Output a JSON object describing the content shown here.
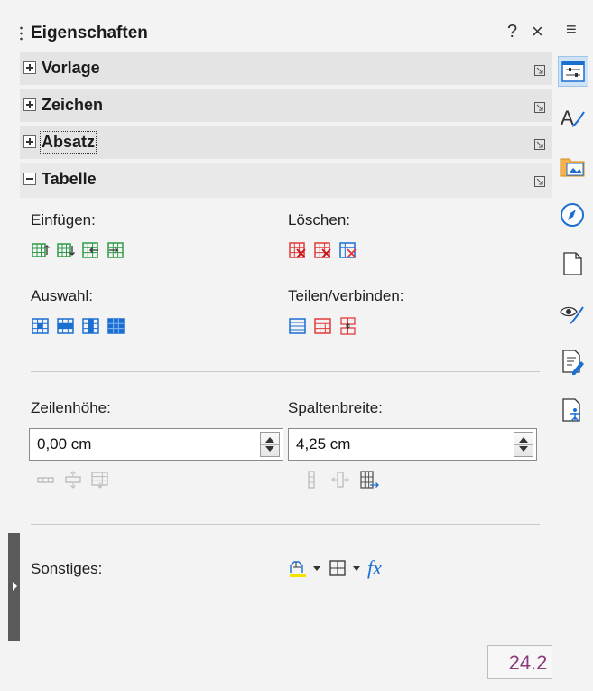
{
  "panel": {
    "title": "Eigenschaften",
    "help_label": "?",
    "close_label": "×"
  },
  "sections": [
    {
      "label": "Vorlage",
      "expanded": false
    },
    {
      "label": "Zeichen",
      "expanded": false
    },
    {
      "label": "Absatz",
      "expanded": false
    },
    {
      "label": "Tabelle",
      "expanded": true
    }
  ],
  "table": {
    "insert_label": "Einfügen:",
    "delete_label": "Löschen:",
    "select_label": "Auswahl:",
    "split_merge_label": "Teilen/verbinden:",
    "row_height_label": "Zeilenhöhe:",
    "row_height_value": "0,00 cm",
    "column_width_label": "Spaltenbreite:",
    "column_width_value": "4,25 cm",
    "misc_label": "Sonstiges:",
    "formula_label": "fx",
    "insert_icons": [
      "insert-rows-above-icon",
      "insert-rows-below-icon",
      "insert-columns-before-icon",
      "insert-columns-after-icon"
    ],
    "delete_icons": [
      "delete-rows-icon",
      "delete-columns-icon",
      "delete-table-icon"
    ],
    "select_icons": [
      "select-cell-icon",
      "select-row-icon",
      "select-column-icon",
      "select-table-icon"
    ],
    "split_merge_icons": [
      "split-cells-icon",
      "merge-cells-icon",
      "split-table-icon"
    ],
    "row_size_icons": [
      "minimal-row-height-icon",
      "optimal-row-height-icon",
      "distribute-rows-icon"
    ],
    "col_size_icons": [
      "minimal-column-width-icon",
      "optimal-column-width-icon",
      "distribute-columns-icon"
    ]
  },
  "tabbar": {
    "menu_label": "≡",
    "tabs": [
      "properties-tab-icon",
      "styles-tab-icon",
      "gallery-tab-icon",
      "navigator-tab-icon",
      "page-tab-icon",
      "style-inspector-tab-icon",
      "manage-changes-tab-icon",
      "accessibility-check-tab-icon"
    ]
  },
  "version": "24.2",
  "colors": {
    "accent_blue": "#1a6fd1",
    "delete_red": "#e23b3b",
    "insert_green": "#2e9b48",
    "version_text": "#8b3a7a"
  }
}
